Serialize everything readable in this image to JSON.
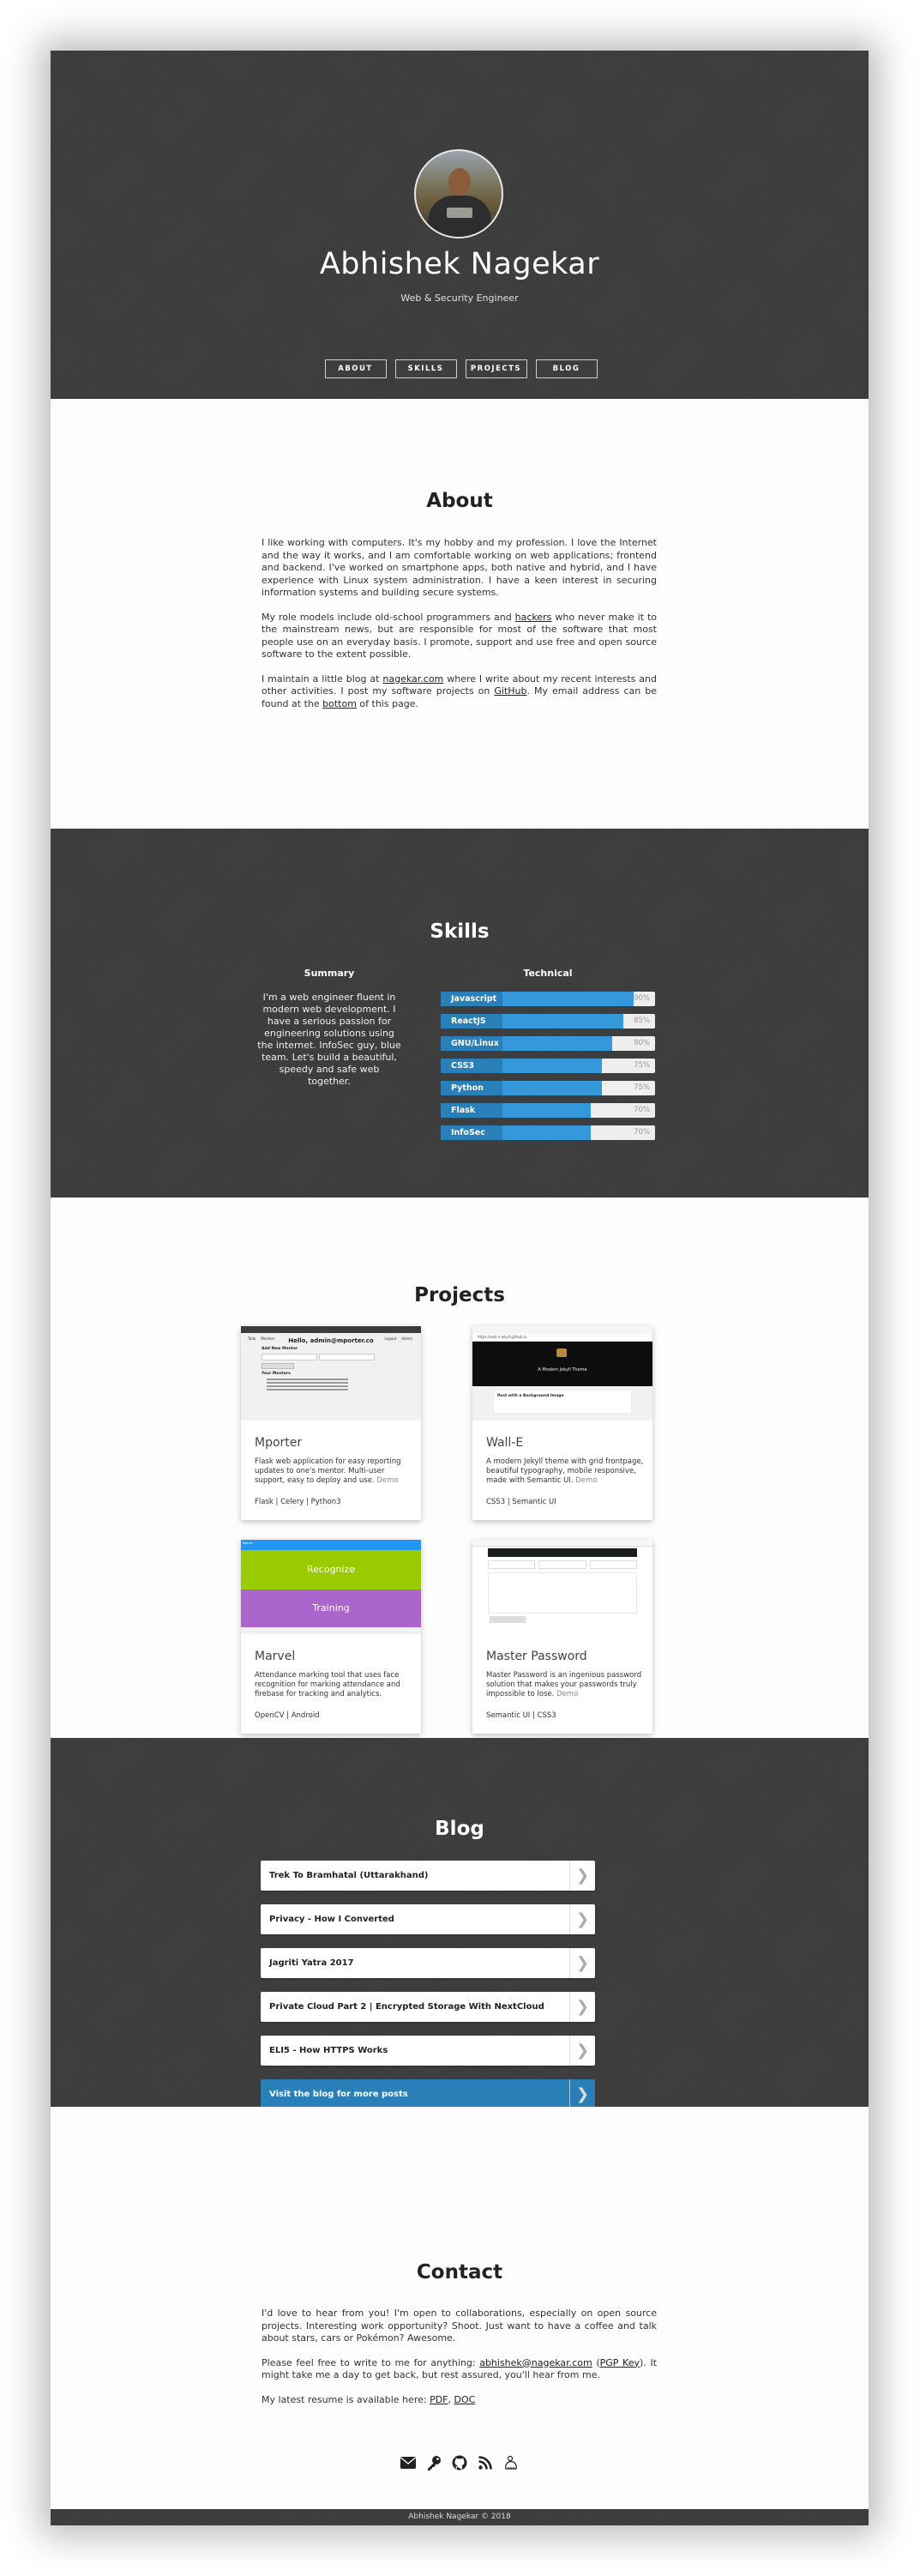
{
  "header": {
    "name": "Abhishek Nagekar",
    "tagline": "Web & Security Engineer",
    "nav": [
      "ABOUT",
      "SKILLS",
      "PROJECTS",
      "BLOG"
    ]
  },
  "about": {
    "title": "About",
    "p1": "I like working with computers. It's my hobby and my profession. I love the Internet and the way it works, and I am comfortable working on web applications; frontend and backend. I've worked on smartphone apps, both native and hybrid, and I have experience with Linux system administration. I have a keen interest in securing information systems and building secure systems.",
    "p2_before": "My role models include old-school programmers and ",
    "p2_link": "hackers",
    "p2_after": " who never make it to the mainstream news, but are responsible for most of the software that most people use on an everyday basis. I promote, support and use free and open source software to the extent possible.",
    "p3_a": "I maintain a little blog at ",
    "p3_link1": "nagekar.com",
    "p3_b": " where I write about my recent interests and other activities. I post my software projects on ",
    "p3_link2": "GitHub",
    "p3_c": ". My email address can be found at the ",
    "p3_link3": "bottom",
    "p3_d": " of this page."
  },
  "skills": {
    "title": "Skills",
    "summary_title": "Summary",
    "summary": "I'm a web engineer fluent in modern web development. I have a serious passion for engineering solutions using the internet. InfoSec guy, blue team. Let's build a beautiful, speedy and safe web together.",
    "technical_title": "Technical",
    "items": [
      {
        "label": "Javascript",
        "percent": 90,
        "pct_label": "90%"
      },
      {
        "label": "ReactJS",
        "percent": 85,
        "pct_label": "85%"
      },
      {
        "label": "GNU/Linux",
        "percent": 80,
        "pct_label": "80%"
      },
      {
        "label": "CSS3",
        "percent": 75,
        "pct_label": "75%"
      },
      {
        "label": "Python",
        "percent": 75,
        "pct_label": "75%"
      },
      {
        "label": "Flask",
        "percent": 70,
        "pct_label": "70%"
      },
      {
        "label": "InfoSec",
        "percent": 70,
        "pct_label": "70%"
      }
    ],
    "colors": {
      "label_bg": "#2980b9",
      "fill": "#3498db",
      "track": "#eeeeee"
    }
  },
  "projects": {
    "title": "Projects",
    "items": [
      {
        "title": "Mporter",
        "desc": "Flask web application for easy reporting updates to one's mentor. Multi-user support, easy to deploy and use.",
        "demo": "Demo",
        "tags": "Flask | Celery | Python3",
        "shot": {
          "hello": "Hello, admin@mporter.co",
          "add": "Add New Mentor",
          "list": "Your Mentors",
          "btn": "Add Mentor"
        }
      },
      {
        "title": "Wall-E",
        "desc": "A modern Jekyll theme with grid frontpage, beautiful typography, mobile responsive, made with Semantic UI.",
        "demo": "Demo",
        "tags": "CSS3 | Semantic UI",
        "shot": {
          "url": "https://wall-e-jekyll.github.io",
          "hero": "A Modern Jekyll Theme",
          "post": "Post with a Background Image"
        }
      },
      {
        "title": "Marvel",
        "desc": "Attendance marking tool that uses face recognition for marking attendance and firebase for tracking and analytics.",
        "demo": "",
        "tags": "OpenCV | Android",
        "shot": {
          "bar": "Marvel",
          "btn1": "Recognize",
          "btn2": "Training"
        }
      },
      {
        "title": "Master Password",
        "desc": "Master Password is an ingenious password solution that makes your passwords truly impossible to lose.",
        "demo": "Demo",
        "tags": "Semantic UI | CSS3",
        "shot": {}
      }
    ]
  },
  "blog": {
    "title": "Blog",
    "posts": [
      "Trek To Bramhatal (Uttarakhand)",
      "Privacy - How I Converted",
      "Jagriti Yatra 2017",
      "Private Cloud Part 2 | Encrypted Storage With NextCloud",
      "ELI5 - How HTTPS Works"
    ],
    "more": "Visit the blog for more posts",
    "accent": "#2980b9"
  },
  "contact": {
    "title": "Contact",
    "p1": "I'd love to hear from you! I'm open to collaborations, especially on open source projects. Interesting work opportunity? Shoot. Just want to have a coffee and talk about stars, cars or Pokémon? Awesome.",
    "p2_a": "Please feel free to write to me for anything: ",
    "email": "abhishek@nagekar.com",
    "p2_b": " (",
    "pgp": "PGP Key",
    "p2_c": "). It might take me a day to get back, but rest assured, you'll hear from me.",
    "p3": "My latest resume is available here: ",
    "pdf": "PDF",
    "sep": ", ",
    "doc": "DOC",
    "icons": [
      "envelope-icon",
      "key-icon",
      "github-icon",
      "rss-icon",
      "keybase-icon"
    ]
  },
  "footer": {
    "text": "Abhishek Nagekar © 2018"
  }
}
